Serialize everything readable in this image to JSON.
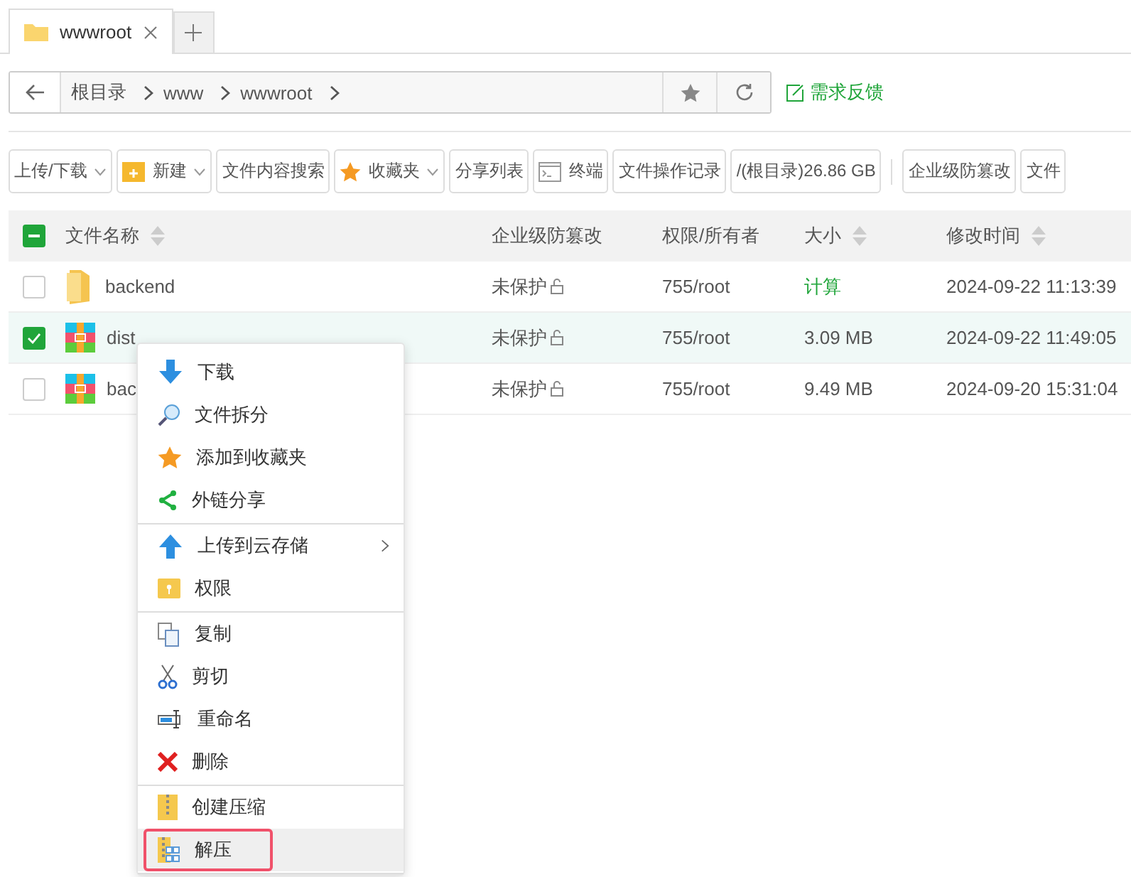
{
  "tabs": [
    {
      "label": "wwwroot",
      "selected": true
    }
  ],
  "breadcrumb": [
    "根目录",
    "www",
    "wwwroot"
  ],
  "feedback": "需求反馈",
  "toolbar": [
    [
      {
        "label": "上传/下载",
        "caret": true
      },
      {
        "label": "新建",
        "caret": true
      },
      {
        "label": "文件内容搜索",
        "caret": false
      },
      {
        "label": "收藏夹",
        "caret": true
      },
      {
        "label": "分享列表",
        "caret": false
      },
      {
        "label": "终端",
        "caret": false
      },
      {
        "label": "文件操作记录",
        "caret": false
      },
      {
        "label": "/(根目录)26.86 GB",
        "caret": false
      }
    ],
    [
      {
        "label": "企业级防篡改",
        "caret": false
      },
      {
        "label": "文件",
        "caret": false
      }
    ]
  ],
  "table": {
    "select_all": {
      "indeterminate": true
    },
    "columns": [
      {
        "label": "文件名称",
        "sortable": true
      },
      {
        "label": "企业级防篡改",
        "sortable": false
      },
      {
        "label": "权限/所有者",
        "sortable": false
      },
      {
        "label": "大小",
        "sortable": true
      },
      {
        "label": "修改时间",
        "sortable": true
      }
    ],
    "rows": [
      {
        "kind": "folder",
        "name": "backend",
        "protect": "未保护",
        "perm": "755/root",
        "size": "计算",
        "size_is_link": true,
        "time": "2024-09-22 11:13:39",
        "selected": false
      },
      {
        "kind": "archive",
        "name": "dist",
        "protect": "未保护",
        "perm": "755/root",
        "size": "3.09 MB",
        "size_is_link": false,
        "time": "2024-09-22 11:49:05",
        "selected": true
      },
      {
        "kind": "archive",
        "name": "bac",
        "protect": "未保护",
        "perm": "755/root",
        "size": "9.49 MB",
        "size_is_link": false,
        "time": "2024-09-20 15:31:04",
        "selected": false
      }
    ]
  },
  "menu": [
    [
      {
        "label": "下载",
        "submenu": false,
        "selected": false
      },
      {
        "label": "文件拆分",
        "submenu": false,
        "selected": false
      },
      {
        "label": "添加到收藏夹",
        "submenu": false,
        "selected": false
      },
      {
        "label": "外链分享",
        "submenu": false,
        "selected": false
      }
    ],
    [
      {
        "label": "上传到云存储",
        "submenu": true,
        "selected": false
      },
      {
        "label": "权限",
        "submenu": false,
        "selected": false
      }
    ],
    [
      {
        "label": "复制",
        "submenu": false,
        "selected": false
      },
      {
        "label": "剪切",
        "submenu": false,
        "selected": false
      },
      {
        "label": "重命名",
        "submenu": false,
        "selected": false
      },
      {
        "label": "删除",
        "submenu": false,
        "selected": false
      }
    ],
    [
      {
        "label": "创建压缩",
        "submenu": false,
        "selected": false
      },
      {
        "label": "解压",
        "submenu": false,
        "selected": true
      }
    ]
  ]
}
